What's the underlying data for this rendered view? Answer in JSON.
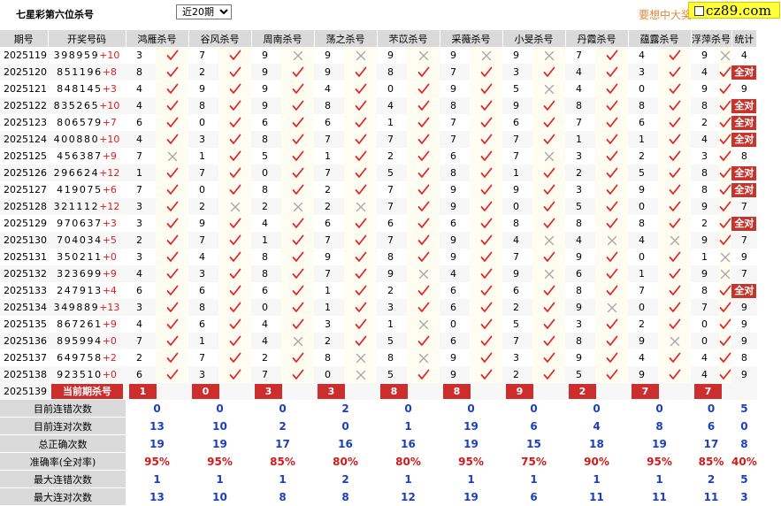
{
  "header": {
    "title": "七星彩第六位杀号",
    "period_select": {
      "selected": "近20期",
      "options": [
        "近20期"
      ]
    },
    "promo": "要想中大奖",
    "logo": "cz89.com"
  },
  "columns": [
    "期号",
    "开奖号码",
    "鸿雁杀号",
    "谷风杀号",
    "周南杀号",
    "荡之杀号",
    "芣苡杀号",
    "采薇杀号",
    "小旻杀号",
    "丹霞杀号",
    "蕴露杀号",
    "浮萍杀号",
    "统计"
  ],
  "rows": [
    {
      "period": "2025119",
      "digits": "398959",
      "plus": "+10",
      "picks": [
        [
          3,
          1
        ],
        [
          7,
          1
        ],
        [
          9,
          0
        ],
        [
          9,
          0
        ],
        [
          9,
          0
        ],
        [
          9,
          0
        ],
        [
          9,
          0
        ],
        [
          7,
          1
        ],
        [
          4,
          1
        ],
        [
          9,
          0
        ]
      ],
      "stat": "4"
    },
    {
      "period": "2025120",
      "digits": "851196",
      "plus": "+8",
      "picks": [
        [
          8,
          1
        ],
        [
          2,
          1
        ],
        [
          9,
          1
        ],
        [
          9,
          1
        ],
        [
          8,
          1
        ],
        [
          7,
          1
        ],
        [
          3,
          1
        ],
        [
          4,
          1
        ],
        [
          3,
          1
        ],
        [
          4,
          1
        ]
      ],
      "stat": "全对"
    },
    {
      "period": "2025121",
      "digits": "848145",
      "plus": "+3",
      "picks": [
        [
          4,
          1
        ],
        [
          9,
          1
        ],
        [
          9,
          1
        ],
        [
          4,
          1
        ],
        [
          0,
          1
        ],
        [
          9,
          1
        ],
        [
          5,
          0
        ],
        [
          4,
          1
        ],
        [
          0,
          1
        ],
        [
          9,
          1
        ]
      ],
      "stat": "9"
    },
    {
      "period": "2025122",
      "digits": "835265",
      "plus": "+10",
      "picks": [
        [
          4,
          1
        ],
        [
          8,
          1
        ],
        [
          9,
          1
        ],
        [
          8,
          1
        ],
        [
          4,
          1
        ],
        [
          8,
          1
        ],
        [
          9,
          1
        ],
        [
          8,
          1
        ],
        [
          8,
          1
        ],
        [
          8,
          1
        ]
      ],
      "stat": "全对"
    },
    {
      "period": "2025123",
      "digits": "806579",
      "plus": "+7",
      "picks": [
        [
          6,
          1
        ],
        [
          0,
          1
        ],
        [
          6,
          1
        ],
        [
          6,
          1
        ],
        [
          1,
          1
        ],
        [
          7,
          1
        ],
        [
          6,
          1
        ],
        [
          7,
          1
        ],
        [
          6,
          1
        ],
        [
          2,
          1
        ]
      ],
      "stat": "全对"
    },
    {
      "period": "2025124",
      "digits": "400880",
      "plus": "+10",
      "picks": [
        [
          4,
          1
        ],
        [
          3,
          1
        ],
        [
          8,
          1
        ],
        [
          7,
          1
        ],
        [
          7,
          1
        ],
        [
          7,
          1
        ],
        [
          7,
          1
        ],
        [
          1,
          1
        ],
        [
          1,
          1
        ],
        [
          4,
          1
        ]
      ],
      "stat": "全对"
    },
    {
      "period": "2025125",
      "digits": "456387",
      "plus": "+9",
      "picks": [
        [
          7,
          0
        ],
        [
          1,
          1
        ],
        [
          5,
          1
        ],
        [
          1,
          1
        ],
        [
          2,
          1
        ],
        [
          6,
          1
        ],
        [
          7,
          0
        ],
        [
          3,
          1
        ],
        [
          2,
          1
        ],
        [
          3,
          1
        ]
      ],
      "stat": "8"
    },
    {
      "period": "2025126",
      "digits": "296624",
      "plus": "+12",
      "picks": [
        [
          1,
          1
        ],
        [
          7,
          1
        ],
        [
          0,
          1
        ],
        [
          7,
          1
        ],
        [
          5,
          1
        ],
        [
          8,
          1
        ],
        [
          1,
          1
        ],
        [
          2,
          1
        ],
        [
          5,
          1
        ],
        [
          8,
          1
        ]
      ],
      "stat": "全对"
    },
    {
      "period": "2025127",
      "digits": "419075",
      "plus": "+6",
      "picks": [
        [
          7,
          1
        ],
        [
          0,
          1
        ],
        [
          8,
          1
        ],
        [
          2,
          1
        ],
        [
          7,
          1
        ],
        [
          9,
          1
        ],
        [
          9,
          1
        ],
        [
          3,
          1
        ],
        [
          9,
          1
        ],
        [
          8,
          1
        ]
      ],
      "stat": "全对"
    },
    {
      "period": "2025128",
      "digits": "321112",
      "plus": "+12",
      "picks": [
        [
          3,
          1
        ],
        [
          2,
          0
        ],
        [
          2,
          0
        ],
        [
          2,
          0
        ],
        [
          7,
          1
        ],
        [
          9,
          1
        ],
        [
          0,
          1
        ],
        [
          5,
          1
        ],
        [
          0,
          1
        ],
        [
          9,
          1
        ]
      ],
      "stat": "7"
    },
    {
      "period": "2025129",
      "digits": "970637",
      "plus": "+3",
      "picks": [
        [
          3,
          1
        ],
        [
          9,
          1
        ],
        [
          4,
          1
        ],
        [
          6,
          1
        ],
        [
          6,
          1
        ],
        [
          6,
          1
        ],
        [
          8,
          1
        ],
        [
          8,
          1
        ],
        [
          8,
          1
        ],
        [
          2,
          1
        ]
      ],
      "stat": "全对"
    },
    {
      "period": "2025130",
      "digits": "704034",
      "plus": "+5",
      "picks": [
        [
          2,
          1
        ],
        [
          7,
          1
        ],
        [
          1,
          1
        ],
        [
          7,
          1
        ],
        [
          7,
          1
        ],
        [
          9,
          1
        ],
        [
          4,
          0
        ],
        [
          4,
          0
        ],
        [
          4,
          0
        ],
        [
          9,
          1
        ]
      ],
      "stat": "7"
    },
    {
      "period": "2025131",
      "digits": "350211",
      "plus": "+0",
      "picks": [
        [
          3,
          1
        ],
        [
          4,
          1
        ],
        [
          8,
          1
        ],
        [
          9,
          1
        ],
        [
          8,
          1
        ],
        [
          9,
          1
        ],
        [
          7,
          1
        ],
        [
          9,
          1
        ],
        [
          0,
          1
        ],
        [
          1,
          0
        ]
      ],
      "stat": "9"
    },
    {
      "period": "2025132",
      "digits": "323699",
      "plus": "+9",
      "picks": [
        [
          4,
          1
        ],
        [
          3,
          1
        ],
        [
          8,
          1
        ],
        [
          7,
          1
        ],
        [
          9,
          0
        ],
        [
          4,
          1
        ],
        [
          9,
          0
        ],
        [
          6,
          1
        ],
        [
          1,
          1
        ],
        [
          9,
          0
        ]
      ],
      "stat": "7"
    },
    {
      "period": "2025133",
      "digits": "247913",
      "plus": "+4",
      "picks": [
        [
          6,
          1
        ],
        [
          6,
          1
        ],
        [
          6,
          1
        ],
        [
          1,
          1
        ],
        [
          2,
          1
        ],
        [
          6,
          1
        ],
        [
          6,
          1
        ],
        [
          8,
          1
        ],
        [
          7,
          1
        ],
        [
          8,
          1
        ]
      ],
      "stat": "全对"
    },
    {
      "period": "2025134",
      "digits": "349889",
      "plus": "+13",
      "picks": [
        [
          3,
          1
        ],
        [
          8,
          1
        ],
        [
          0,
          1
        ],
        [
          1,
          1
        ],
        [
          3,
          1
        ],
        [
          6,
          1
        ],
        [
          2,
          1
        ],
        [
          9,
          0
        ],
        [
          0,
          1
        ],
        [
          7,
          1
        ]
      ],
      "stat": "9"
    },
    {
      "period": "2025135",
      "digits": "867261",
      "plus": "+9",
      "picks": [
        [
          4,
          1
        ],
        [
          6,
          1
        ],
        [
          4,
          1
        ],
        [
          3,
          1
        ],
        [
          1,
          0
        ],
        [
          0,
          1
        ],
        [
          5,
          1
        ],
        [
          3,
          1
        ],
        [
          2,
          1
        ],
        [
          0,
          1
        ]
      ],
      "stat": "9"
    },
    {
      "period": "2025136",
      "digits": "895994",
      "plus": "+0",
      "picks": [
        [
          7,
          1
        ],
        [
          1,
          1
        ],
        [
          4,
          0
        ],
        [
          2,
          1
        ],
        [
          5,
          1
        ],
        [
          6,
          1
        ],
        [
          7,
          1
        ],
        [
          8,
          1
        ],
        [
          9,
          0
        ],
        [
          0,
          1
        ]
      ],
      "stat": "9"
    },
    {
      "period": "2025137",
      "digits": "649758",
      "plus": "+2",
      "picks": [
        [
          2,
          1
        ],
        [
          7,
          1
        ],
        [
          2,
          1
        ],
        [
          8,
          0
        ],
        [
          8,
          0
        ],
        [
          9,
          1
        ],
        [
          3,
          1
        ],
        [
          9,
          1
        ],
        [
          4,
          1
        ],
        [
          4,
          1
        ]
      ],
      "stat": "8"
    },
    {
      "period": "2025138",
      "digits": "923510",
      "plus": "+0",
      "picks": [
        [
          6,
          1
        ],
        [
          3,
          1
        ],
        [
          7,
          1
        ],
        [
          0,
          0
        ],
        [
          5,
          1
        ],
        [
          9,
          1
        ],
        [
          2,
          1
        ],
        [
          5,
          1
        ],
        [
          9,
          1
        ],
        [
          4,
          1
        ]
      ],
      "stat": "9"
    }
  ],
  "current": {
    "period": "2025139",
    "label": "当前期杀号",
    "picks": [
      1,
      0,
      3,
      3,
      8,
      8,
      9,
      2,
      7,
      7
    ]
  },
  "summary": [
    {
      "label": "目前连错次数",
      "values": [
        "0",
        "0",
        "0",
        "2",
        "0",
        "0",
        "0",
        "0",
        "0",
        "0"
      ],
      "stat": "5",
      "color": "blue"
    },
    {
      "label": "目前连对次数",
      "values": [
        "13",
        "10",
        "2",
        "0",
        "1",
        "19",
        "6",
        "4",
        "8",
        "6"
      ],
      "stat": "0",
      "color": "blue"
    },
    {
      "label": "总正确次数",
      "values": [
        "19",
        "19",
        "17",
        "16",
        "16",
        "19",
        "15",
        "18",
        "19",
        "17"
      ],
      "stat": "8",
      "color": "blue"
    },
    {
      "label": "准确率(全对率)",
      "values": [
        "95%",
        "95%",
        "85%",
        "80%",
        "80%",
        "95%",
        "75%",
        "90%",
        "95%",
        "85%"
      ],
      "stat": "40%",
      "color": "red"
    },
    {
      "label": "最大连错次数",
      "values": [
        "1",
        "1",
        "1",
        "2",
        "1",
        "1",
        "1",
        "1",
        "1",
        "2"
      ],
      "stat": "5",
      "color": "blue"
    },
    {
      "label": "最大连对次数",
      "values": [
        "13",
        "10",
        "8",
        "8",
        "12",
        "19",
        "6",
        "11",
        "11",
        "11"
      ],
      "stat": "3",
      "color": "blue"
    }
  ],
  "colors": {
    "check": "#e0282a",
    "cross": "#a8a8a8",
    "badge": "#c8332c",
    "blue": "#1b3fbf",
    "red": "#d11a1a"
  }
}
